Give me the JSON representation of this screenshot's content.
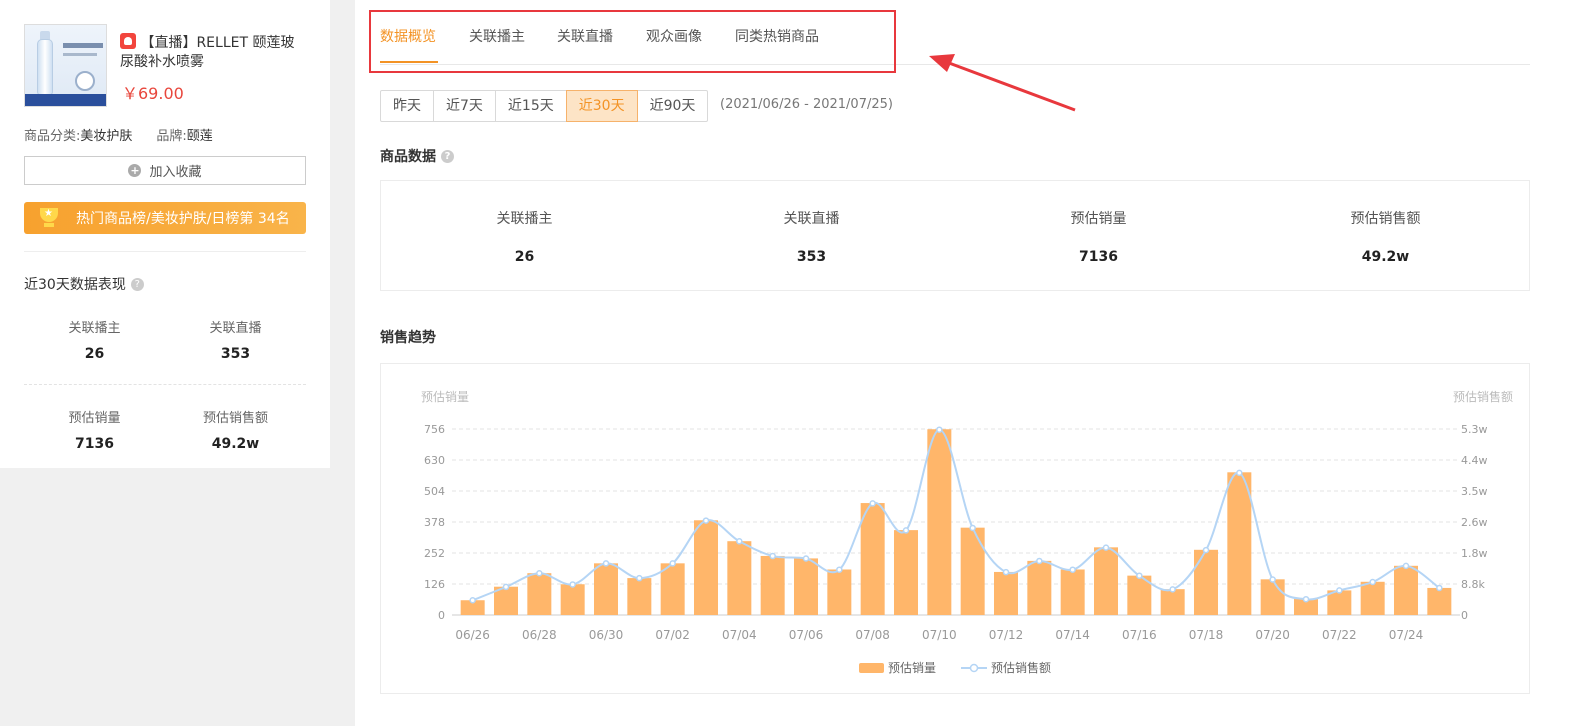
{
  "product": {
    "title": "【直播】RELLET 颐莲玻尿酸补水喷雾",
    "price": "￥69.00",
    "category_label": "商品分类:",
    "category_value": "美妆护肤",
    "brand_label": "品牌:",
    "brand_value": "颐莲",
    "favorite_label": "加入收藏",
    "rank_text": "热门商品榜/美妆护肤/日榜第 34名"
  },
  "performance": {
    "title": "近30天数据表现",
    "items": [
      {
        "label": "关联播主",
        "value": "26"
      },
      {
        "label": "关联直播",
        "value": "353"
      },
      {
        "label": "预估销量",
        "value": "7136"
      },
      {
        "label": "预估销售额",
        "value": "49.2w"
      }
    ]
  },
  "tabs": [
    {
      "label": "数据概览",
      "active": true
    },
    {
      "label": "关联播主",
      "active": false
    },
    {
      "label": "关联直播",
      "active": false
    },
    {
      "label": "观众画像",
      "active": false
    },
    {
      "label": "同类热销商品",
      "active": false
    }
  ],
  "ranges": [
    {
      "label": "昨天",
      "active": false
    },
    {
      "label": "近7天",
      "active": false
    },
    {
      "label": "近15天",
      "active": false
    },
    {
      "label": "近30天",
      "active": true
    },
    {
      "label": "近90天",
      "active": false
    }
  ],
  "date_range": "(2021/06/26 - 2021/07/25)",
  "product_data": {
    "title": "商品数据",
    "items": [
      {
        "label": "关联播主",
        "value": "26"
      },
      {
        "label": "关联直播",
        "value": "353"
      },
      {
        "label": "预估销量",
        "value": "7136"
      },
      {
        "label": "预估销售额",
        "value": "49.2w"
      }
    ]
  },
  "sales_trend_title": "销售趋势",
  "colors": {
    "accent": "#f39325",
    "bar": "#ffb66a",
    "line": "#b5d5f5",
    "highlight": "#e8383d"
  },
  "chart_data": {
    "type": "bar",
    "y_axis_left_title": "预估销量",
    "y_axis_right_title": "预估销售额",
    "y_ticks_left": [
      "0",
      "126",
      "252",
      "378",
      "504",
      "630",
      "756"
    ],
    "y_ticks_right": [
      "0",
      "8.8k",
      "1.8w",
      "2.6w",
      "3.5w",
      "4.4w",
      "5.3w"
    ],
    "x_tick_labels": [
      "06/26",
      "06/28",
      "06/30",
      "07/02",
      "07/04",
      "07/06",
      "07/08",
      "07/10",
      "07/12",
      "07/14",
      "07/16",
      "07/18",
      "07/20",
      "07/22",
      "07/24"
    ],
    "ylim": [
      0,
      756
    ],
    "categories": [
      "06/26",
      "06/27",
      "06/28",
      "06/29",
      "06/30",
      "07/01",
      "07/02",
      "07/03",
      "07/04",
      "07/05",
      "07/06",
      "07/07",
      "07/08",
      "07/09",
      "07/10",
      "07/11",
      "07/12",
      "07/13",
      "07/14",
      "07/15",
      "07/16",
      "07/17",
      "07/18",
      "07/19",
      "07/20",
      "07/21",
      "07/22",
      "07/23",
      "07/24",
      "07/25"
    ],
    "series": [
      {
        "name": "预估销量",
        "type": "bar",
        "values": [
          60,
          115,
          170,
          125,
          210,
          150,
          210,
          385,
          300,
          240,
          230,
          185,
          455,
          345,
          755,
          355,
          175,
          220,
          185,
          275,
          160,
          105,
          265,
          580,
          145,
          65,
          100,
          135,
          200,
          110
        ]
      },
      {
        "name": "预估销售额",
        "type": "line",
        "values": [
          0.42,
          0.8,
          1.19,
          0.87,
          1.47,
          1.05,
          1.47,
          2.69,
          2.1,
          1.68,
          1.61,
          1.29,
          3.18,
          2.41,
          5.28,
          2.48,
          1.22,
          1.54,
          1.29,
          1.92,
          1.12,
          0.73,
          1.85,
          4.05,
          1.01,
          0.45,
          0.7,
          0.94,
          1.4,
          0.77
        ],
        "ylim": [
          0,
          5.3
        ]
      }
    ],
    "legend": [
      "预估销量",
      "预估销售额"
    ],
    "legend_position": "bottom-center",
    "grid": true
  }
}
